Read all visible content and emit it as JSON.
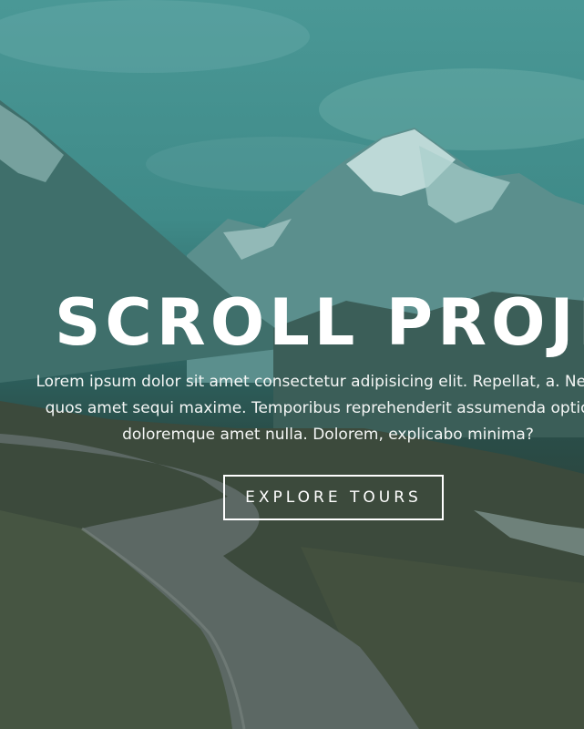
{
  "hero": {
    "title": "SCROLL PROJECT",
    "text_lines": [
      "Lorem ipsum dolor sit amet consectetur adipisicing elit. Repellat, a. Neque,",
      "quos amet sequi maxime. Temporibus reprehenderit assumenda optio ut",
      "doloremque amet nulla. Dolorem, explicabo minima?"
    ],
    "button_label": "EXPLORE TOURS"
  },
  "colors": {
    "overlay_tint": "#3f8a88",
    "text": "#ffffff"
  }
}
